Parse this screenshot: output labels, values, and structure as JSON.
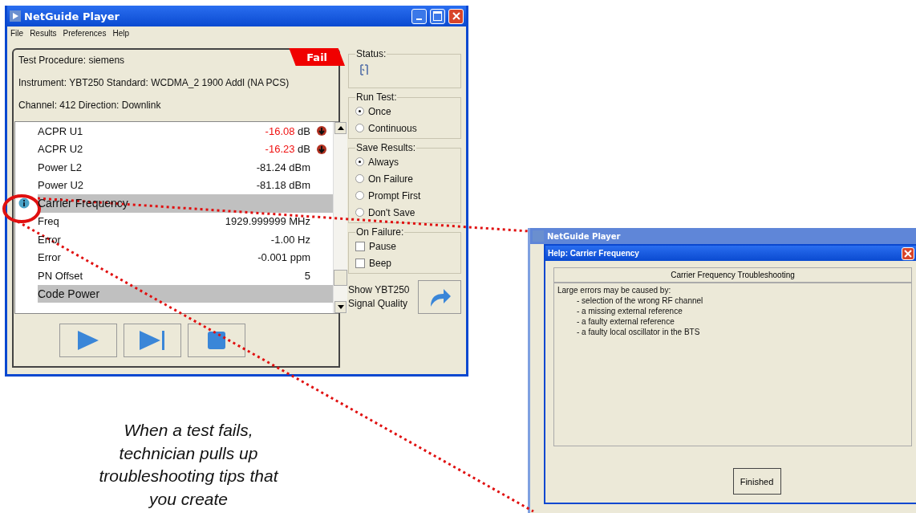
{
  "main_window": {
    "title": "NetGuide Player",
    "menu": [
      "File",
      "Results",
      "Preferences",
      "Help"
    ],
    "procedure": "Test Procedure: siemens",
    "result_tab": {
      "label": "Fail",
      "failed": true
    },
    "instrument": "Instrument: YBT250 Standard: WCDMA_2 1900 Addl (NA PCS)",
    "channel": "Channel: 412 Direction: Downlink",
    "results": [
      {
        "kind": "row",
        "label": "ACPR U1",
        "value": "-16.08",
        "unit": "dB",
        "failed": true
      },
      {
        "kind": "row",
        "label": "ACPR U2",
        "value": "-16.23",
        "unit": "dB",
        "failed": true
      },
      {
        "kind": "row",
        "label": "Power L2",
        "value": "-81.24",
        "unit": "dBm",
        "failed": false
      },
      {
        "kind": "row",
        "label": "Power U2",
        "value": "-81.18",
        "unit": "dBm",
        "failed": false
      },
      {
        "kind": "header",
        "label": "Carrier Frequency",
        "info": true
      },
      {
        "kind": "row",
        "label": "Freq",
        "value": "1929.999999",
        "unit": "MHz",
        "failed": false
      },
      {
        "kind": "row",
        "label": "Error",
        "value": "-1.00",
        "unit": "Hz",
        "failed": false
      },
      {
        "kind": "row",
        "label": "Error",
        "value": "-0.001",
        "unit": "ppm",
        "failed": false
      },
      {
        "kind": "row",
        "label": "PN Offset",
        "value": "5",
        "failed": false
      },
      {
        "kind": "header",
        "label": "Code Power",
        "info": false
      }
    ],
    "status": {
      "title": "Status:"
    },
    "run_test": {
      "title": "Run Test:",
      "options": [
        {
          "label": "Once",
          "selected": true
        },
        {
          "label": "Continuous",
          "selected": false
        }
      ]
    },
    "save_results": {
      "title": "Save Results:",
      "options": [
        {
          "label": "Always",
          "selected": true
        },
        {
          "label": "On Failure",
          "selected": false
        },
        {
          "label": "Prompt First",
          "selected": false
        },
        {
          "label": "Don't Save",
          "selected": false
        }
      ]
    },
    "on_failure": {
      "title": "On Failure:",
      "options": [
        {
          "label": "Pause",
          "checked": false
        },
        {
          "label": "Beep",
          "checked": false
        }
      ]
    },
    "signal_quality": [
      "Show YBT250",
      "Signal Quality"
    ]
  },
  "caption": [
    "When a test fails,",
    "technician pulls up",
    "troubleshooting tips that",
    "you create"
  ],
  "help_window": {
    "background_title": "NetGuide Player",
    "title": "Help: Carrier Frequency",
    "heading": "Carrier Frequency Troubleshooting",
    "lines": [
      {
        "text": "Large errors may be caused by:",
        "kind": "intro"
      },
      {
        "text": "- selection of the wrong RF channel",
        "kind": "bullet"
      },
      {
        "text": "- a missing external reference",
        "kind": "bullet"
      },
      {
        "text": "- a faulty external reference",
        "kind": "bullet"
      },
      {
        "text": "- a faulty local oscillator in the BTS",
        "kind": "bullet"
      }
    ],
    "button": "Finished"
  }
}
